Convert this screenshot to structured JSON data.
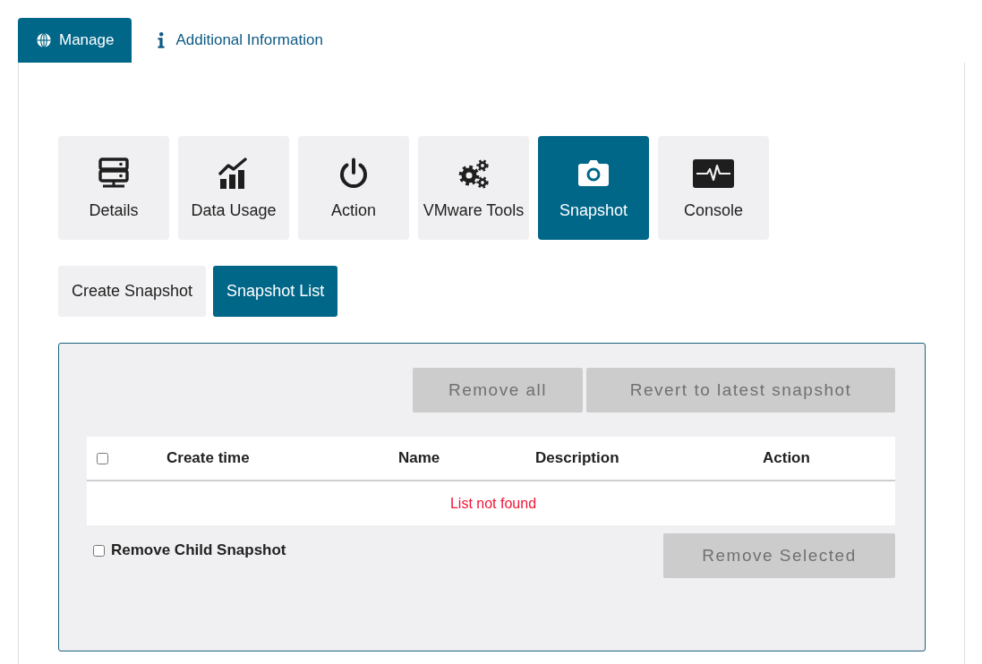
{
  "tabs": [
    {
      "label": "Manage",
      "selected": true
    },
    {
      "label": "Additional Information",
      "selected": false
    }
  ],
  "tools": [
    {
      "label": "Details",
      "selected": false
    },
    {
      "label": "Data Usage",
      "selected": false
    },
    {
      "label": "Action",
      "selected": false
    },
    {
      "label": "VMware Tools",
      "selected": false
    },
    {
      "label": "Snapshot",
      "selected": true
    },
    {
      "label": "Console",
      "selected": false
    }
  ],
  "subtabs": [
    {
      "label": "Create Snapshot",
      "selected": false
    },
    {
      "label": "Snapshot List",
      "selected": true
    }
  ],
  "panel": {
    "buttons": [
      {
        "label": "Remove all",
        "disabled": true
      },
      {
        "label": "Revert to latest snapshot",
        "disabled": true
      }
    ],
    "table": {
      "select_all_checked": false,
      "columns": [
        "Create time",
        "Name",
        "Description",
        "Action"
      ],
      "empty_message": "List not found"
    },
    "remove_child": {
      "label": "Remove Child Snapshot",
      "checked": false
    },
    "remove_selected": {
      "label": "Remove Selected",
      "disabled": true
    }
  }
}
